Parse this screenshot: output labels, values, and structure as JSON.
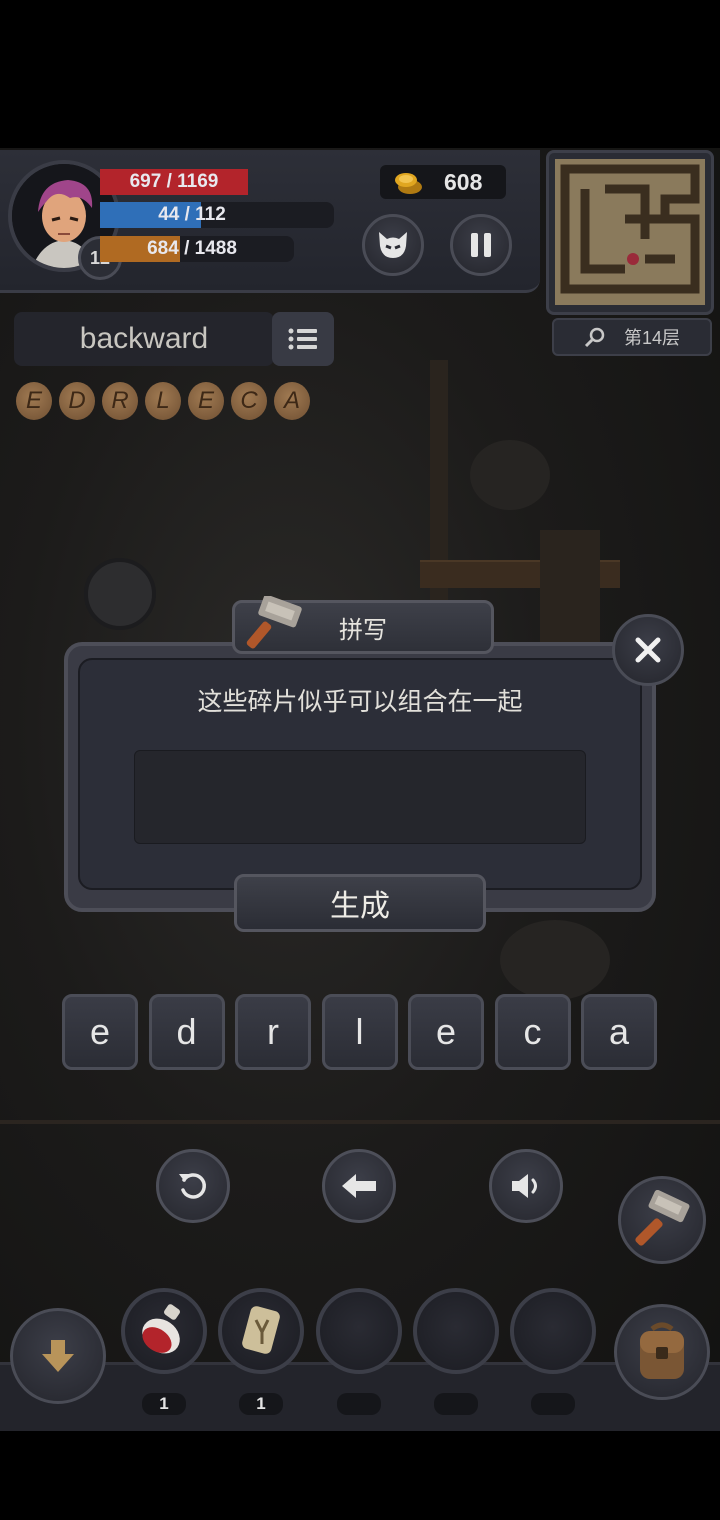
{
  "hud": {
    "hp": "697 / 1169",
    "mp": "44 / 112",
    "xp": "684 / 1488",
    "hp_ratio": 0.596,
    "mp_ratio": 0.393,
    "xp_ratio": 0.46,
    "level": "12",
    "gold": "608",
    "floor": "第14层"
  },
  "word": {
    "target": "backward",
    "runes": [
      "E",
      "D",
      "R",
      "L",
      "E",
      "C",
      "A"
    ]
  },
  "dialog": {
    "title": "拼写",
    "message": "这些碎片似乎可以组合在一起",
    "input_value": "",
    "generate_label": "生成"
  },
  "letters": [
    "e",
    "d",
    "r",
    "l",
    "e",
    "c",
    "a"
  ],
  "inventory": {
    "slots": [
      {
        "item": "red-potion",
        "count": "1"
      },
      {
        "item": "rune-stone",
        "count": "1"
      },
      {
        "item": "",
        "count": ""
      },
      {
        "item": "",
        "count": ""
      },
      {
        "item": "",
        "count": ""
      }
    ]
  },
  "colors": {
    "hp": "#b3242b",
    "mp": "#2f6fb8",
    "xp": "#b06a22",
    "gold": "#e0a620"
  }
}
